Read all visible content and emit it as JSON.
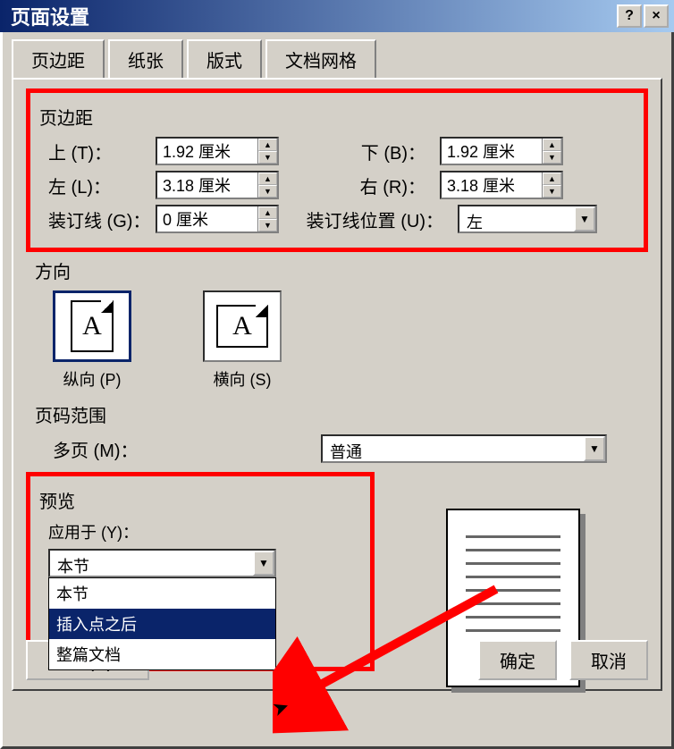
{
  "window": {
    "title": "页面设置",
    "help_btn": "?",
    "close_btn": "×"
  },
  "tabs": [
    "页边距",
    "纸张",
    "版式",
    "文档网格"
  ],
  "margins": {
    "group_label": "页边距",
    "top_label": "上 (T)：",
    "top_value": "1.92 厘米",
    "bottom_label": "下 (B)：",
    "bottom_value": "1.92 厘米",
    "left_label": "左 (L)：",
    "left_value": "3.18 厘米",
    "right_label": "右 (R)：",
    "right_value": "3.18 厘米",
    "gutter_label": "装订线 (G)：",
    "gutter_value": "0 厘米",
    "gutter_pos_label": "装订线位置 (U)：",
    "gutter_pos_value": "左"
  },
  "orientation": {
    "group_label": "方向",
    "portrait_label": "纵向 (P)",
    "landscape_label": "横向 (S)",
    "glyph": "A"
  },
  "pages": {
    "group_label": "页码范围",
    "multipage_label": "多页 (M)：",
    "multipage_value": "普通"
  },
  "preview": {
    "group_label": "预览",
    "apply_label": "应用于 (Y)：",
    "apply_value": "本节",
    "options": [
      "本节",
      "插入点之后",
      "整篇文档"
    ]
  },
  "buttons": {
    "default": "默认 (D)...",
    "ok": "确定",
    "cancel": "取消"
  }
}
